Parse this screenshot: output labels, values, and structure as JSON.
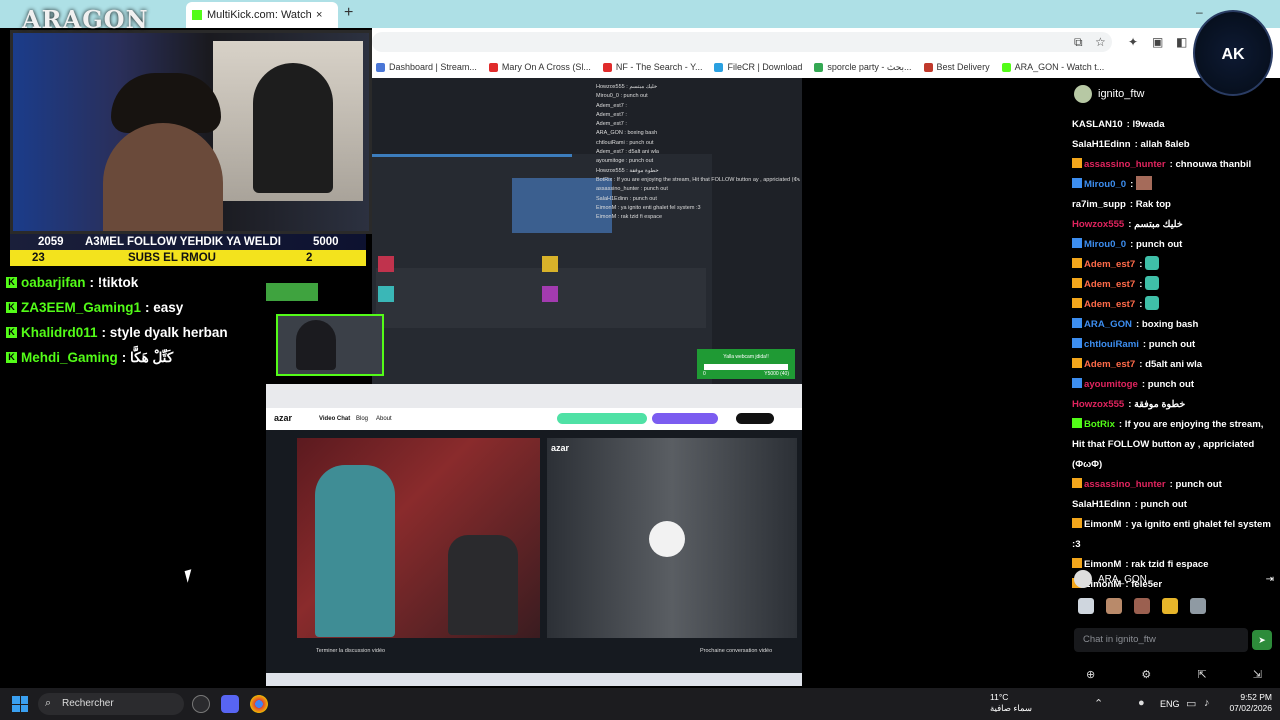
{
  "browser": {
    "active_tab_title": "MultiKick.com: Watch Multi",
    "close_icon": "×",
    "new_tab_icon": "+",
    "minimize_icon": "–",
    "bookmarks": [
      {
        "label": "Dashboard | Stream...",
        "color": "#4a76d6"
      },
      {
        "label": "Mary On A Cross (Sl...",
        "color": "#e02b2b"
      },
      {
        "label": "NF - The Search - Y...",
        "color": "#e02b2b"
      },
      {
        "label": "FileCR | Download",
        "color": "#2aa0e0"
      },
      {
        "label": "sporcle party - بحث...",
        "color": "#34a853"
      },
      {
        "label": "Best Delivery",
        "color": "#c0392b"
      },
      {
        "label": "ARA_GON - Watch t...",
        "color": "#53fc18"
      }
    ]
  },
  "overlay": {
    "logo": "ARAGON",
    "goal1": {
      "left": "2059",
      "text": "A3MEL FOLLOW YEHDIK YA WELDI",
      "right": "5000"
    },
    "goal2": {
      "left": "23",
      "text": "SUBS EL RMOU",
      "right": "2"
    }
  },
  "kick_chat": [
    {
      "user": "oabarjifan",
      "text": ": !tiktok",
      "badge": "K",
      "user_color": "#53fc18"
    },
    {
      "user": "ZA3EEM_Gaming1",
      "text": ": easy",
      "badge": "K",
      "user_color": "#53fc18"
    },
    {
      "user": "Khalidrd011",
      "text": ": style dyalk herban",
      "badge": "K",
      "user_color": "#53fc18"
    },
    {
      "user": "Mehdi_Gaming",
      "text": ": كَتِّلْ هَكَّا",
      "badge": "K",
      "user_color": "#53fc18"
    }
  ],
  "mini_chat": [
    "Howzox555 : خليك مبتسم",
    "Mirou0_0 : punch out",
    "Adem_est7 :",
    "Adem_est7 :",
    "Adem_est7 :",
    "ARA_GON : boxing bash",
    "chtlouiRami : punch out",
    "Adem_est7 : d5alt ani wla",
    "ayoumitoge : punch out",
    "Howzox555 : خطوة موفقة",
    "BotRix : If you are enjoying the stream, Hit that FOLLOW button ay , appriciated (ΦωΦ)",
    "assassino_hunter : punch out",
    "SalaH1Edinn : punch out",
    "EimonM : ya ignito enti ghalet fel system :3",
    "EimonM : rak tzid fi espace"
  ],
  "yalla": {
    "text": "Yalla webcam jdida!!",
    "start": "0",
    "end": "Y5000 (40)"
  },
  "azar": {
    "logo": "azar",
    "nav": [
      "Video Chat",
      "Blog",
      "About"
    ],
    "end_label": "Terminer la discussion vidéo",
    "next_label": "Prochaine conversation vidéo"
  },
  "right_chat": {
    "channel": "ignito_ftw",
    "messages": [
      {
        "user": "KASLAN10",
        "text": "l9wada",
        "color": "#ffffff",
        "badge": ""
      },
      {
        "user": "SalaH1Edinn",
        "text": "allah 8aleb",
        "color": "#ffffff",
        "badge": ""
      },
      {
        "user": "assassino_hunter",
        "text": "chnouwa thanbil",
        "color": "#e0245e",
        "badge": "crown"
      },
      {
        "user": "Mirou0_0",
        "text": "",
        "color": "#3d8ef0",
        "badge": "blue",
        "emote": "pic"
      },
      {
        "user": "ra7im_supp",
        "text": "Rak top",
        "color": "#ffffff",
        "badge": ""
      },
      {
        "user": "Howzox555",
        "text": "خليك مبتسم",
        "color": "#e0245e",
        "badge": ""
      },
      {
        "user": "Mirou0_0",
        "text": "punch out",
        "color": "#3d8ef0",
        "badge": "blue"
      },
      {
        "user": "Adem_est7",
        "text": "",
        "color": "#ff6b4a",
        "badge": "crown",
        "emote": "green"
      },
      {
        "user": "Adem_est7",
        "text": "",
        "color": "#ff6b4a",
        "badge": "crown",
        "emote": "green"
      },
      {
        "user": "Adem_est7",
        "text": "",
        "color": "#ff6b4a",
        "badge": "crown",
        "emote": "green"
      },
      {
        "user": "ARA_GON",
        "text": "boxing bash",
        "color": "#3d8ef0",
        "badge": "blue"
      },
      {
        "user": "chtlouiRami",
        "text": "punch out",
        "color": "#3d8ef0",
        "badge": "blue"
      },
      {
        "user": "Adem_est7",
        "text": "d5alt ani wla",
        "color": "#ff6b4a",
        "badge": "crown"
      },
      {
        "user": "ayoumitoge",
        "text": "punch out",
        "color": "#e0245e",
        "badge": "blue"
      },
      {
        "user": "Howzox555",
        "text": "خطوة موفقة",
        "color": "#e0245e",
        "badge": ""
      },
      {
        "user": "BotRix",
        "text": "If you are enjoying the stream, Hit that FOLLOW button ay , appriciated (ΦωΦ)",
        "color": "#53fc18",
        "badge": "green"
      },
      {
        "user": "assassino_hunter",
        "text": "punch out",
        "color": "#e0245e",
        "badge": "crown"
      },
      {
        "user": "SalaH1Edinn",
        "text": "punch out",
        "color": "#ffffff",
        "badge": ""
      },
      {
        "user": "EimonM",
        "text": "ya ignito enti ghalet fel system :3",
        "color": "#ffffff",
        "badge": "crown"
      },
      {
        "user": "EimonM",
        "text": "rak tzid fi espace",
        "color": "#ffffff",
        "badge": "crown"
      },
      {
        "user": "EimonM",
        "text": "fele5er",
        "color": "#ffffff",
        "badge": "crown"
      }
    ],
    "current_user": "ARA_GON",
    "input_placeholder": "Chat in ignito_ftw",
    "ak_logo": "AK"
  },
  "taskbar": {
    "search_label": "Rechercher",
    "weather_temp": "11°C",
    "weather_desc": "سماء صافية",
    "lang": "ENG",
    "time": "9:52 PM",
    "date": "07/02/2026"
  }
}
